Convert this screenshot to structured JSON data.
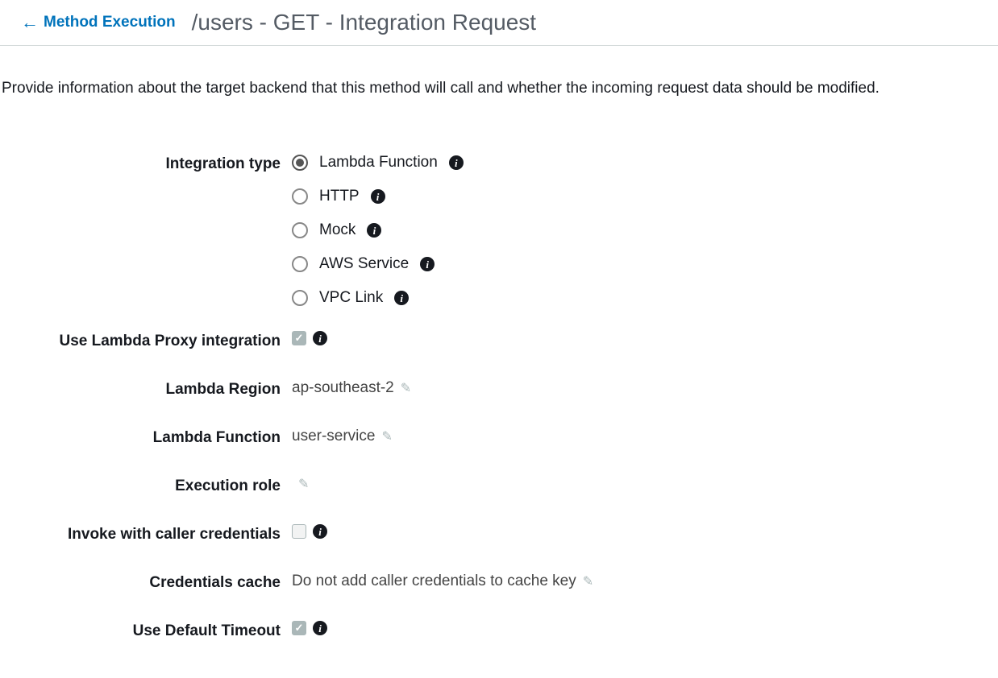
{
  "header": {
    "back_label": "Method Execution",
    "title": "/users - GET - Integration Request"
  },
  "description": "Provide information about the target backend that this method will call and whether the incoming request data should be modified.",
  "labels": {
    "integration_type": "Integration type",
    "lambda_proxy": "Use Lambda Proxy integration",
    "lambda_region": "Lambda Region",
    "lambda_function": "Lambda Function",
    "execution_role": "Execution role",
    "invoke_caller": "Invoke with caller credentials",
    "credentials_cache": "Credentials cache",
    "default_timeout": "Use Default Timeout"
  },
  "integration_type_options": {
    "lambda": "Lambda Function",
    "http": "HTTP",
    "mock": "Mock",
    "aws": "AWS Service",
    "vpc": "VPC Link",
    "selected": "lambda"
  },
  "values": {
    "lambda_proxy_checked": true,
    "lambda_region": "ap-southeast-2",
    "lambda_function": "user-service",
    "execution_role": "",
    "invoke_caller_checked": false,
    "credentials_cache": "Do not add caller credentials to cache key",
    "default_timeout_checked": true
  }
}
